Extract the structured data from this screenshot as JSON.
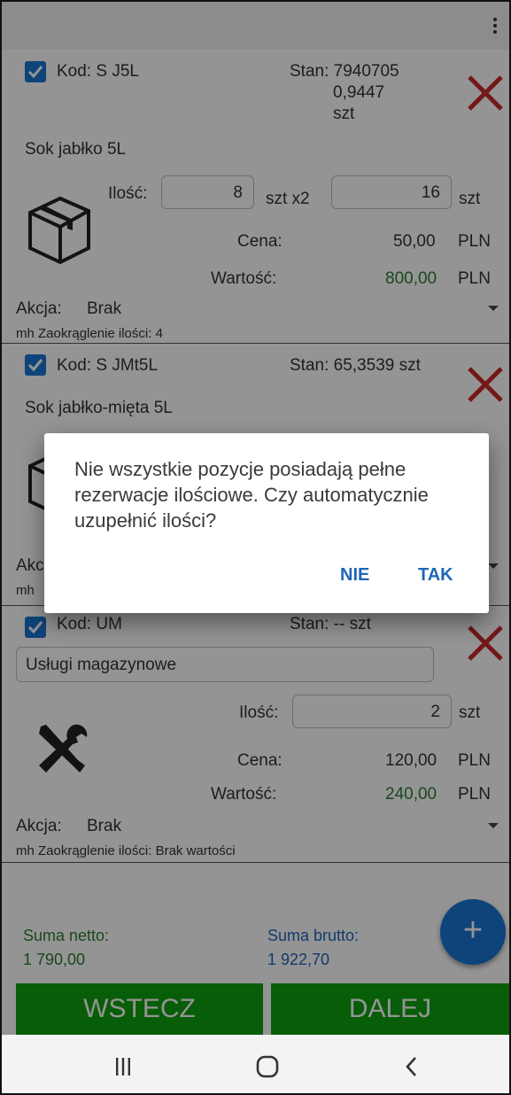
{
  "items": [
    {
      "code": "Kod: S J5L",
      "stock_line1": "Stan: 7940705",
      "stock_line2": "0,9447",
      "stock_line3": "szt",
      "name": "Sok jabłko 5L",
      "qty_label": "Ilość:",
      "qty": "8",
      "unit_mult": "szt x2",
      "qty_total": "16",
      "unit": "szt",
      "price_label": "Cena:",
      "price": "50,00",
      "currency": "PLN",
      "value_label": "Wartość:",
      "value": "800,00",
      "value_currency": "PLN",
      "action_label": "Akcja:",
      "action": "Brak",
      "rounding": "mh Zaokrąglenie ilości: 4",
      "icon": "box-icon"
    },
    {
      "code": "Kod: S JMt5L",
      "stock": "Stan: 65,3539 szt",
      "name": "Sok jabłko-mięta 5L",
      "action_label_partial": "Akc",
      "rounding_partial": "mh",
      "icon": "box-icon"
    },
    {
      "code": "Kod: UM",
      "stock": "Stan: -- szt",
      "name": "Usługi magazynowe",
      "qty_label": "Ilość:",
      "qty": "2",
      "unit": "szt",
      "price_label": "Cena:",
      "price": "120,00",
      "currency": "PLN",
      "value_label": "Wartość:",
      "value": "240,00",
      "value_currency": "PLN",
      "action_label": "Akcja:",
      "action": "Brak",
      "rounding": "mh Zaokrąglenie ilości: Brak wartości",
      "icon": "tools-icon"
    }
  ],
  "summary": {
    "net_label": "Suma netto:",
    "net_value": "1 790,00",
    "gross_label": "Suma brutto:",
    "gross_value": "1 922,70"
  },
  "fab_label": "+",
  "buttons": {
    "back": "WSTECZ",
    "next": "DALEJ"
  },
  "dialog": {
    "message": "Nie wszystkie pozycje posiadają pełne rezerwacje ilościowe. Czy automatycznie uzupełnić ilości?",
    "negative": "NIE",
    "positive": "TAK"
  },
  "colors": {
    "accent": "#1976d2",
    "primary_button": "#0fa10f",
    "delete": "#c62828",
    "value_green": "#2e7d32"
  }
}
